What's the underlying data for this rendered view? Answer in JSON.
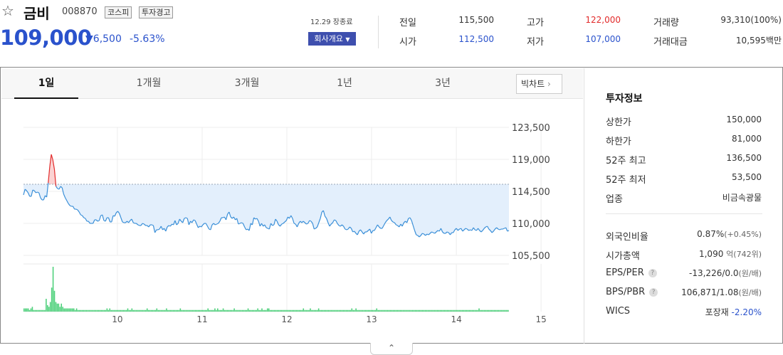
{
  "stock": {
    "name": "금비",
    "code": "008870",
    "badges": [
      "코스피",
      "투자경고"
    ],
    "price": "109,000",
    "change": "6,500",
    "rate": "-5.63%",
    "status": "12.29 장종료",
    "corp_button": "회사개요"
  },
  "quote": {
    "prev_close_label": "전일",
    "prev_close": "115,500",
    "open_label": "시가",
    "open": "112,500",
    "high_label": "고가",
    "high": "122,000",
    "low_label": "저가",
    "low": "107,000",
    "volume_label": "거래량",
    "volume": "93,310(100%)",
    "amount_label": "거래대금",
    "amount": "10,595백만"
  },
  "tabs": [
    "1일",
    "1개월",
    "3개월",
    "1년",
    "3년"
  ],
  "big_chart_label": "빅차트",
  "investment": {
    "title": "투자정보",
    "upper_limit_label": "상한가",
    "upper_limit": "150,000",
    "lower_limit_label": "하한가",
    "lower_limit": "81,000",
    "high52_label": "52주 최고",
    "high52": "136,500",
    "low52_label": "52주 최저",
    "low52": "53,500",
    "sector_label": "업종",
    "sector": "비금속광물",
    "foreign_label": "외국인비율",
    "foreign": "0.87%",
    "foreign_change": "(+0.45%)",
    "mcap_label": "시가총액",
    "mcap": "1,090",
    "mcap_unit": "억",
    "mcap_rank": "(742위)",
    "eps_label": "EPS/PER",
    "eps": "-13,226/0.0",
    "eps_unit": "(원/배)",
    "bps_label": "BPS/PBR",
    "bps": "106,871/1.08",
    "bps_unit": "(원/배)",
    "wics_label": "WICS",
    "wics": "포장재",
    "wics_change": "-2.20%"
  },
  "colors": {
    "blue": "#2a52cc",
    "red": "#e22a2a",
    "line": "#3a8fd8",
    "fill_blue": "#e3effc",
    "fill_red": "#fbd3d3",
    "volume": "#4cd07a"
  },
  "chart_data": {
    "type": "line",
    "y_ticks": [
      123500,
      119000,
      114500,
      110000,
      105500
    ],
    "y_tick_labels": [
      "123,500",
      "119,000",
      "114,500",
      "110,000",
      "105,500"
    ],
    "ylim": [
      105500,
      123500
    ],
    "reference_price": 115500,
    "x_tick_labels": [
      "10",
      "11",
      "12",
      "13",
      "14",
      "15"
    ],
    "x_tick_positions": [
      9,
      17,
      25,
      33,
      41,
      49
    ],
    "price_series": [
      114000,
      114800,
      114600,
      114300,
      113800,
      113800,
      114700,
      114600,
      114300,
      114400,
      114300,
      113600,
      113300,
      113300,
      113900,
      113700,
      115700,
      118000,
      119700,
      118900,
      117600,
      115200,
      114900,
      114800,
      115200,
      115000,
      114100,
      113600,
      113200,
      112800,
      112500,
      112400,
      112400,
      112000,
      112000,
      111900,
      111600,
      111200,
      111100,
      110800,
      110700,
      110300,
      110300,
      110000,
      110000,
      110000,
      110500,
      110500,
      110300,
      110400,
      111100,
      111200,
      110400,
      110300,
      110800,
      110800,
      110200,
      110200,
      111100,
      111000,
      111500,
      111700,
      111400,
      110800,
      110200,
      110100,
      110100,
      110300,
      110100,
      110400,
      110600,
      110100,
      110000,
      110000,
      109800,
      109700,
      109700,
      110000,
      109900,
      109700,
      109700,
      109500,
      109800,
      109800,
      109700,
      108700,
      109100,
      109100,
      109200,
      109600,
      109100,
      109300,
      108900,
      109500,
      109700,
      109600,
      109900,
      109800,
      110400,
      109800,
      110000,
      110600,
      110300,
      110100,
      110700,
      110800,
      110700,
      109800,
      110300,
      110100,
      110500,
      110400,
      109900,
      109400,
      109600,
      109500,
      109800,
      110000,
      110000,
      109600,
      109200,
      109100,
      109800,
      110000,
      109800,
      109900,
      110000,
      110300,
      110800,
      110800,
      110900,
      110500,
      111300,
      111600,
      110900,
      110700,
      110900,
      110500,
      110700,
      109900,
      110000,
      110100,
      110000,
      109500,
      109100,
      109200,
      109000,
      110000,
      109800,
      110800,
      110600,
      110700,
      110300,
      109600,
      110000,
      109600,
      109800,
      109400,
      109300,
      109200,
      110000,
      109700,
      109800,
      110600,
      110300,
      109800,
      109600,
      109900,
      110000,
      110200,
      110400,
      110900,
      110700,
      111100,
      110700,
      110000,
      109900,
      109500,
      110000,
      110300,
      110100,
      110300,
      110100,
      109900,
      110000,
      110400,
      110300,
      110000,
      109200,
      109300,
      109500,
      110100,
      110700,
      111600,
      111800,
      111000,
      110700,
      110100,
      109600,
      109900,
      110100,
      110500,
      110400,
      110000,
      109700,
      109600,
      109800,
      109600,
      109200,
      109100,
      109200,
      109500,
      109300,
      108800,
      108900,
      108600,
      108400,
      108900,
      109100,
      108800,
      108500,
      108800,
      108800,
      109000,
      109200,
      108600,
      109000,
      109000,
      109400,
      109800,
      109500,
      109300,
      109300,
      109700,
      110100,
      110400,
      110600,
      110900,
      110400,
      110200,
      110100,
      109800,
      109700,
      109500,
      109900,
      109600,
      110100,
      110300,
      110100,
      110700,
      110800,
      110400,
      109700,
      109000,
      108400,
      108300,
      108100,
      108300,
      108600,
      108500,
      108300,
      108500,
      108400,
      108600,
      108800,
      108700,
      108600,
      108800,
      109000,
      108900,
      109300,
      108800,
      108600,
      108600,
      108800,
      108700,
      108400,
      108700,
      108700,
      109100,
      109300,
      109000,
      109200,
      109300,
      108900,
      109100,
      109300,
      109200,
      109000,
      109100,
      109000,
      109400,
      109100,
      109000,
      109300,
      109000,
      108800,
      109000,
      109300,
      109500,
      109600,
      109200,
      109000,
      108700,
      108900,
      109200,
      109400,
      109200,
      109100,
      109200,
      109200,
      109300,
      109400,
      108900,
      109000
    ],
    "volume_series": [
      2,
      2,
      2,
      2,
      1,
      2,
      3,
      1,
      1,
      1,
      1,
      1,
      1,
      1,
      1,
      1,
      8,
      4,
      3,
      6,
      15,
      28,
      13,
      6,
      5,
      5,
      3,
      5,
      3,
      2,
      2,
      2,
      2,
      2,
      2,
      2,
      2,
      1,
      2,
      1,
      1,
      1,
      1,
      1,
      1,
      1,
      1,
      1,
      1,
      1,
      1,
      1,
      1,
      1,
      1,
      1,
      1,
      1,
      1,
      1,
      2,
      1,
      2,
      1,
      1,
      1,
      1,
      1,
      1,
      1,
      1,
      1,
      1,
      1,
      1,
      2,
      1,
      1,
      2,
      1,
      1,
      1,
      1,
      1,
      1,
      1,
      1,
      1,
      1,
      2,
      1,
      1,
      1,
      1,
      1,
      1,
      2,
      1,
      1,
      1,
      1,
      1,
      1,
      2,
      1,
      1,
      1,
      1,
      1,
      1,
      1,
      1,
      1,
      2,
      1,
      1,
      1,
      1,
      1,
      1,
      1,
      1,
      1,
      1,
      1,
      1,
      1,
      1,
      1,
      1,
      1,
      1,
      1,
      2,
      1,
      1,
      1,
      1,
      2,
      1,
      2,
      1,
      1,
      1,
      2,
      1,
      1,
      1,
      1,
      1,
      1,
      1,
      2,
      1,
      1,
      1,
      1,
      1,
      1,
      1,
      1,
      1,
      2,
      1,
      1,
      1,
      1,
      1,
      1,
      2,
      1,
      1,
      2,
      1,
      1,
      1,
      2,
      2,
      1,
      1,
      1,
      1,
      1,
      1,
      1,
      1,
      1,
      1,
      1,
      1,
      1,
      1,
      1,
      1,
      1,
      1,
      1,
      1,
      1,
      1,
      1,
      1,
      2,
      1,
      1,
      1,
      1,
      2,
      1,
      1,
      1,
      1,
      1,
      2,
      1,
      1,
      1,
      1,
      1,
      1,
      1,
      1,
      1,
      1,
      1,
      1,
      1,
      1,
      1,
      1,
      1,
      1,
      1,
      1,
      1,
      1,
      1,
      2,
      1,
      1,
      2,
      1,
      1,
      1,
      1,
      1,
      1,
      1,
      1,
      1,
      1,
      1,
      1,
      1,
      1,
      2,
      1,
      1,
      1,
      1,
      1,
      1,
      1,
      1,
      1,
      1,
      1,
      1,
      1,
      1,
      1,
      1,
      1,
      1,
      1,
      1,
      1,
      1,
      1,
      1,
      1,
      1,
      1,
      1,
      1,
      1,
      1,
      1,
      1,
      1,
      1,
      1,
      1,
      1,
      1,
      1,
      1,
      1,
      1,
      1,
      1,
      1,
      1,
      1,
      1,
      1,
      1,
      1,
      1,
      1,
      1,
      1,
      1,
      1,
      1,
      1,
      1,
      1,
      1,
      1,
      1,
      1,
      1,
      1,
      1,
      1,
      1,
      1,
      1,
      2,
      1,
      1,
      1,
      1,
      1,
      1,
      1,
      1,
      1,
      1,
      1,
      1,
      1,
      1,
      1,
      1,
      1,
      1,
      1,
      1,
      1
    ]
  }
}
